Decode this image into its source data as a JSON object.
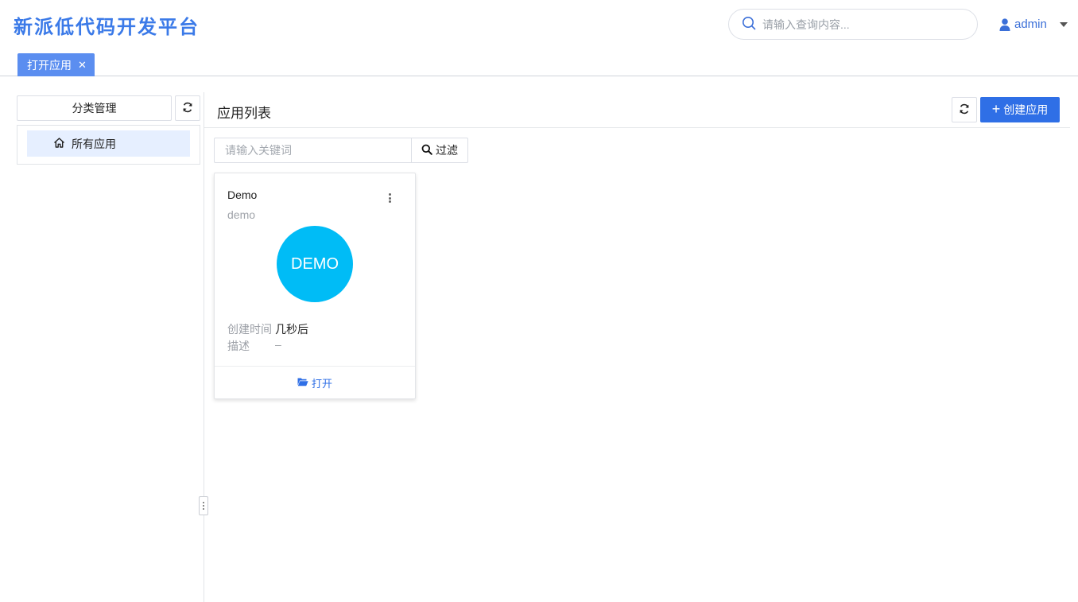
{
  "header": {
    "app_title": "新派低代码开发平台",
    "search_placeholder": "请输入查询内容...",
    "user_name": "admin"
  },
  "tabs": [
    {
      "label": "打开应用",
      "active": true
    }
  ],
  "sidebar": {
    "category_button": "分类管理",
    "tree_items": [
      {
        "label": "所有应用",
        "selected": true
      }
    ]
  },
  "main": {
    "title": "应用列表",
    "create_button": "创建应用",
    "filter_placeholder": "请输入关键词",
    "filter_button": "过滤"
  },
  "apps": [
    {
      "name": "Demo",
      "code": "demo",
      "logo_text": "DEMO",
      "logo_color": "#00bcf6",
      "created_label": "创建时间",
      "created_value": "几秒后",
      "desc_label": "描述",
      "desc_value": "–",
      "open_label": "打开"
    }
  ],
  "colors": {
    "brand": "#3b7ae8",
    "primary": "#2f6fe6",
    "tab_active": "#5b8ef0",
    "tree_selected_bg": "#e6efff"
  }
}
